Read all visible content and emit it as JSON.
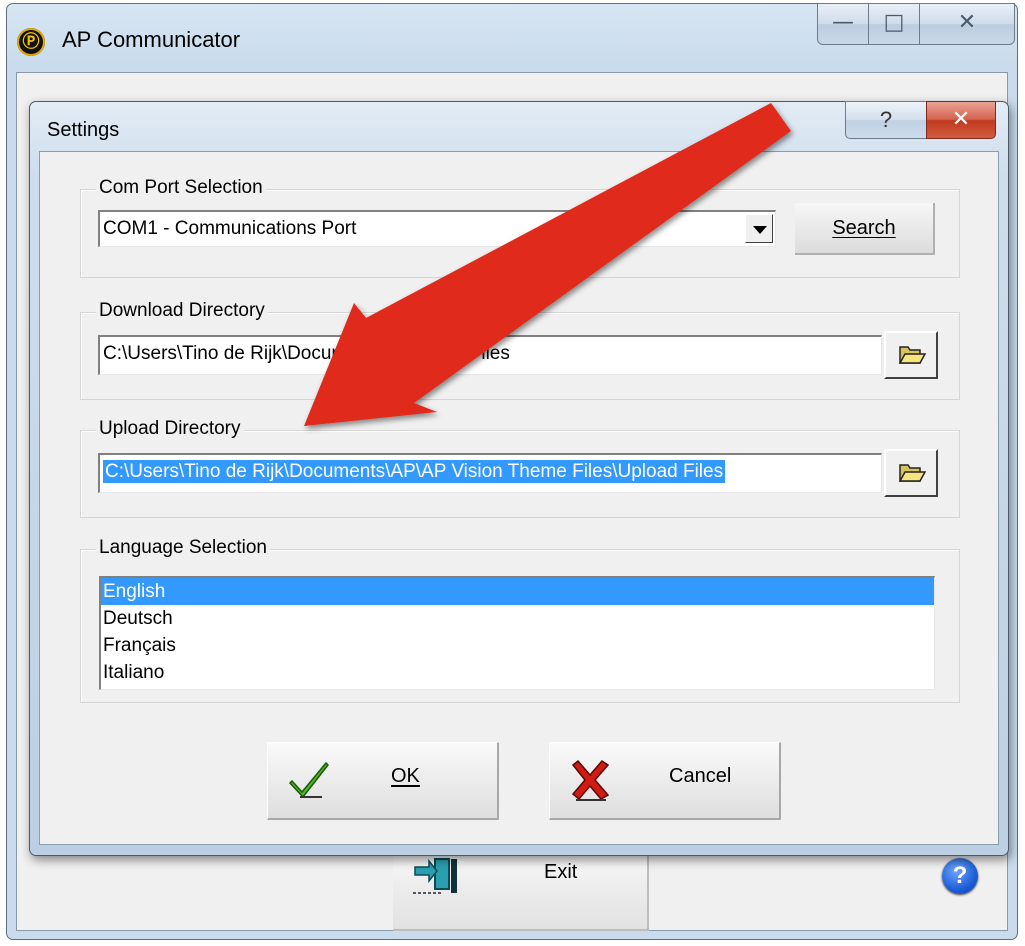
{
  "main_window": {
    "title": "AP Communicator",
    "exit_label": "Exit",
    "controls": {
      "minimize": "—",
      "maximize": "□",
      "close": "✕"
    }
  },
  "settings": {
    "title": "Settings",
    "help_glyph": "?",
    "close_glyph": "✕",
    "com_port": {
      "label": "Com Port Selection",
      "value": "COM1 - Communications Port",
      "search_label": "Search"
    },
    "download": {
      "label": "Download Directory",
      "value": "C:\\Users\\Tino de Rijk\\Documents\\APD Log Files"
    },
    "upload": {
      "label": "Upload Directory",
      "value": "C:\\Users\\Tino de Rijk\\Documents\\AP\\AP Vision Theme Files\\Upload Files"
    },
    "language": {
      "label": "Language Selection",
      "options": [
        "English",
        "Deutsch",
        "Français",
        "Italiano"
      ],
      "selected": "English"
    },
    "ok_label": "OK",
    "cancel_label": "Cancel"
  },
  "colors": {
    "annotation_arrow": "#e0291b",
    "selection": "#3399ff"
  }
}
